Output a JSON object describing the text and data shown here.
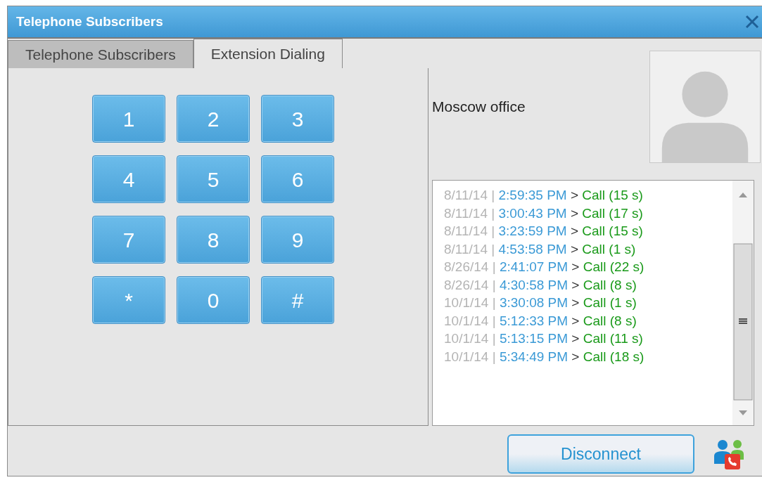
{
  "window": {
    "title": "Telephone Subscribers"
  },
  "tabs": [
    {
      "label": "Telephone Subscribers",
      "selected": false
    },
    {
      "label": "Extension Dialing",
      "selected": true
    }
  ],
  "keypad": [
    "1",
    "2",
    "3",
    "4",
    "5",
    "6",
    "7",
    "8",
    "9",
    "*",
    "0",
    "#"
  ],
  "contact": {
    "name": "Moscow office"
  },
  "call_log": [
    {
      "date": "8/11/14",
      "separator": "|",
      "time": "2:59:35 PM",
      "arrow": ">",
      "event": "Call (15 s)"
    },
    {
      "date": "8/11/14",
      "separator": "|",
      "time": "3:00:43 PM",
      "arrow": ">",
      "event": "Call (17 s)"
    },
    {
      "date": "8/11/14",
      "separator": "|",
      "time": "3:23:59 PM",
      "arrow": ">",
      "event": "Call (15 s)"
    },
    {
      "date": "8/11/14",
      "separator": "|",
      "time": "4:53:58 PM",
      "arrow": ">",
      "event": "Call (1 s)"
    },
    {
      "date": "8/26/14",
      "separator": "|",
      "time": "2:41:07 PM",
      "arrow": ">",
      "event": "Call (22 s)"
    },
    {
      "date": "8/26/14",
      "separator": "|",
      "time": "4:30:58 PM",
      "arrow": ">",
      "event": "Call (8 s)"
    },
    {
      "date": "10/1/14",
      "separator": "|",
      "time": "3:30:08 PM",
      "arrow": ">",
      "event": "Call (1 s)"
    },
    {
      "date": "10/1/14",
      "separator": "|",
      "time": "5:12:33 PM",
      "arrow": ">",
      "event": "Call (8 s)"
    },
    {
      "date": "10/1/14",
      "separator": "|",
      "time": "5:13:15 PM",
      "arrow": ">",
      "event": "Call (11 s)"
    },
    {
      "date": "10/1/14",
      "separator": "|",
      "time": "5:34:49 PM",
      "arrow": ">",
      "event": "Call (18 s)"
    }
  ],
  "buttons": [
    {
      "label": "Disconnect"
    }
  ]
}
